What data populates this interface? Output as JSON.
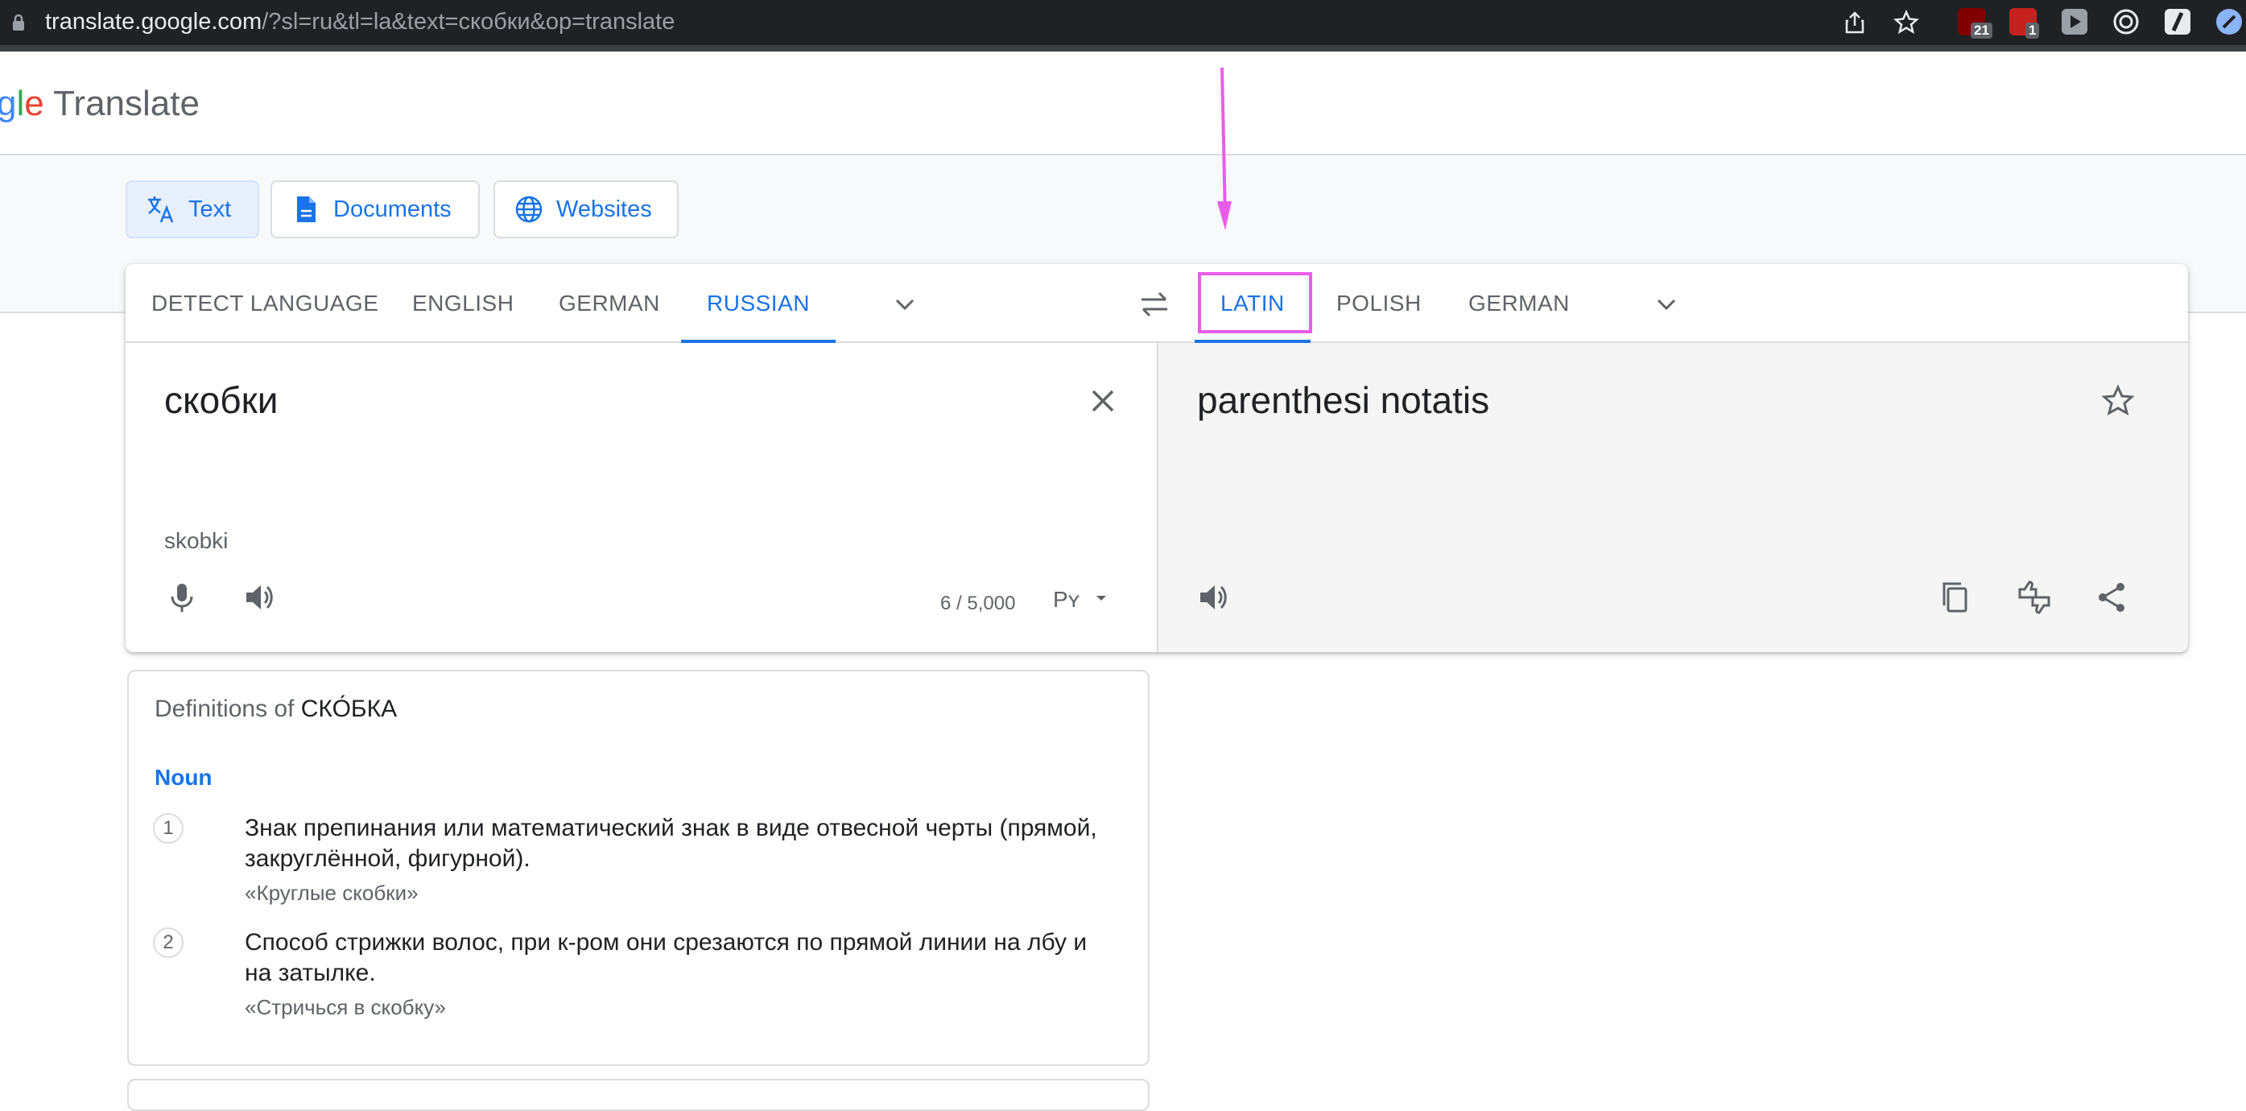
{
  "browser": {
    "url_host": "translate.google.com",
    "url_rest": "/?sl=ru&tl=la&text=скобки&op=translate",
    "extensions": [
      {
        "name": "ublock-icon",
        "badge": "21",
        "color": "#800000"
      },
      {
        "name": "extension-red-icon",
        "badge": "1",
        "color": "#c5221f"
      },
      {
        "name": "play-extension-icon",
        "badge": "",
        "color": "#9aa0a6"
      },
      {
        "name": "target-extension-icon",
        "badge": "",
        "color": "#e8eaed"
      },
      {
        "name": "slash-extension-icon",
        "badge": "",
        "color": "#e8eaed"
      },
      {
        "name": "profile-extension-icon",
        "badge": "",
        "color": "#8ab4f8"
      }
    ]
  },
  "header": {
    "logo_g1": "g",
    "logo_g2": "l",
    "logo_g3": "e",
    "logo_word": " Translate"
  },
  "modes": [
    {
      "label": "Text",
      "active": true
    },
    {
      "label": "Documents",
      "active": false
    },
    {
      "label": "Websites",
      "active": false
    }
  ],
  "source_langs": [
    "DETECT LANGUAGE",
    "ENGLISH",
    "GERMAN",
    "RUSSIAN"
  ],
  "source_active": "RUSSIAN",
  "target_langs": [
    "LATIN",
    "POLISH",
    "GERMAN"
  ],
  "target_active": "LATIN",
  "source": {
    "text": "скобки",
    "transliteration": "skobki",
    "counter": "6 / 5,000"
  },
  "target": {
    "text": "parenthesi notatis"
  },
  "definitions": {
    "title_prefix": "Definitions of ",
    "word": "СКО́БКА",
    "part_of_speech": "Noun",
    "items": [
      {
        "num": "1",
        "text": "Знак препинания или математический знак в виде отвесной черты (прямой, закруглённой, фигурной).",
        "example": "«Круглые скобки»"
      },
      {
        "num": "2",
        "text": "Способ стрижки волос, при к-ром они срезаются по прямой линии на лбу и на затылке.",
        "example": "«Стричься в скобку»"
      }
    ]
  },
  "colors": {
    "accent": "#1a73e8",
    "annotation": "#e95ce9"
  }
}
